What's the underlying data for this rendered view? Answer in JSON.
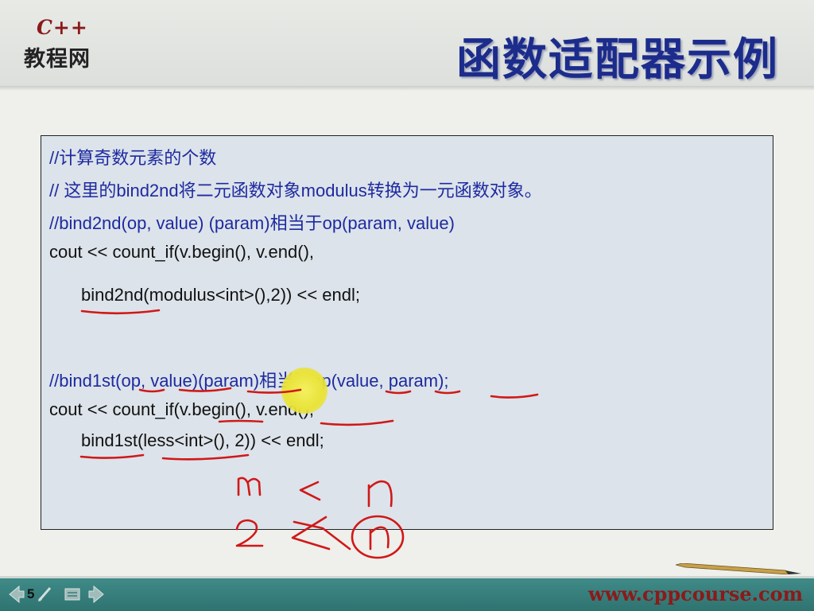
{
  "logo": {
    "top_text": "C++",
    "bottom_text": "教程网"
  },
  "slide": {
    "title": "函数适配器示例",
    "code_lines": [
      "//计算奇数元素的个数",
      "// 这里的bind2nd将二元函数对象modulus转换为一元函数对象。",
      "//bind2nd(op, value) (param)相当于op(param, value)",
      "cout << count_if(v.begin(), v.end(),",
      "bind2nd(modulus<int>(),2)) << endl;",
      "//bind1st(op, value)(param)相当于op(value, param);",
      "cout << count_if(v.begin(), v.end(),",
      "bind1st(less<int>(), 2)) << endl;"
    ],
    "page_number": "5"
  },
  "footer": {
    "site_url": "www.cppcourse.com"
  },
  "colors": {
    "title": "#1c2c8c",
    "comment": "#1e2aa0",
    "ink": "#d01818",
    "logo_red": "#8b1a1a",
    "footer_bar": "#2f7370"
  },
  "icons": [
    "prev-arrow-icon",
    "pen-icon",
    "menu-icon",
    "next-arrow-icon",
    "pencil-icon"
  ]
}
